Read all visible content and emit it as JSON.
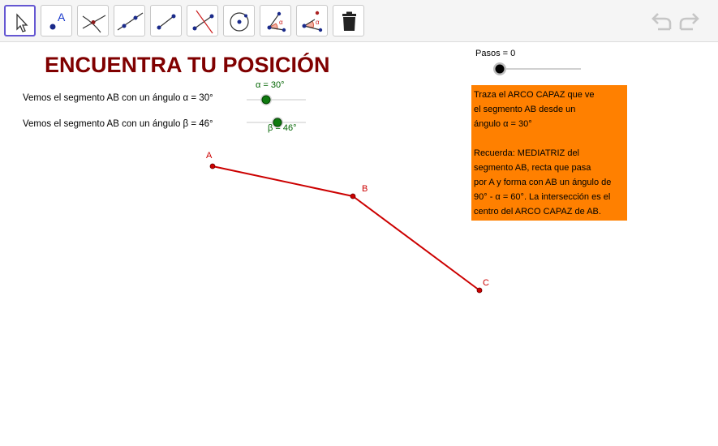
{
  "toolbar": {
    "tools": [
      {
        "name": "move-tool",
        "icon": "arrow-pointer-icon"
      },
      {
        "name": "point-tool",
        "icon": "point-icon",
        "label": "A"
      },
      {
        "name": "intersect-tool",
        "icon": "intersect-icon"
      },
      {
        "name": "line-tool",
        "icon": "line-icon"
      },
      {
        "name": "segment-tool",
        "icon": "segment-icon"
      },
      {
        "name": "perpendicular-bisector-tool",
        "icon": "perpendicular-bisector-icon"
      },
      {
        "name": "circle-tool",
        "icon": "circle-icon"
      },
      {
        "name": "angle-tool",
        "icon": "angle-icon",
        "label": "α"
      },
      {
        "name": "angle-given-size-tool",
        "icon": "angle-given-size-icon",
        "label": "α"
      },
      {
        "name": "delete-tool",
        "icon": "trash-icon"
      }
    ],
    "undo_icon": "undo-icon",
    "redo_icon": "redo-icon"
  },
  "canvas": {
    "title": "ENCUENTRA TU POSICIÓN",
    "sentence_alpha": "Vemos el segmento AB con un ángulo α = 30°",
    "sentence_beta": "Vemos el segmento AB con un ángulo β = 46°",
    "slider_alpha": {
      "label": "α = 30°",
      "value": 30
    },
    "slider_beta": {
      "label": "β = 46°",
      "value": 46
    },
    "slider_steps": {
      "label": "Pasos = 0",
      "value": 0
    },
    "points": {
      "A": "A",
      "B": "B",
      "C": "C"
    },
    "note": {
      "line1": "Traza el ARCO CAPAZ que ve",
      "line2": "el segmento AB desde un",
      "line3": "ángulo α = 30°",
      "line4": "Recuerda: MEDIATRIZ del",
      "line5": "segmento AB, recta que pasa",
      "line6": "por A y forma con AB un ángulo de",
      "line7": "90° - α = 60°. La intersección es el",
      "line8": "centro del ARCO CAPAZ de AB."
    }
  },
  "colors": {
    "title": "#800000",
    "segment": "#cc0000",
    "slider_knob": "#006400",
    "note_background": "#ff8000",
    "toolbar_selected": "#6557d2"
  }
}
